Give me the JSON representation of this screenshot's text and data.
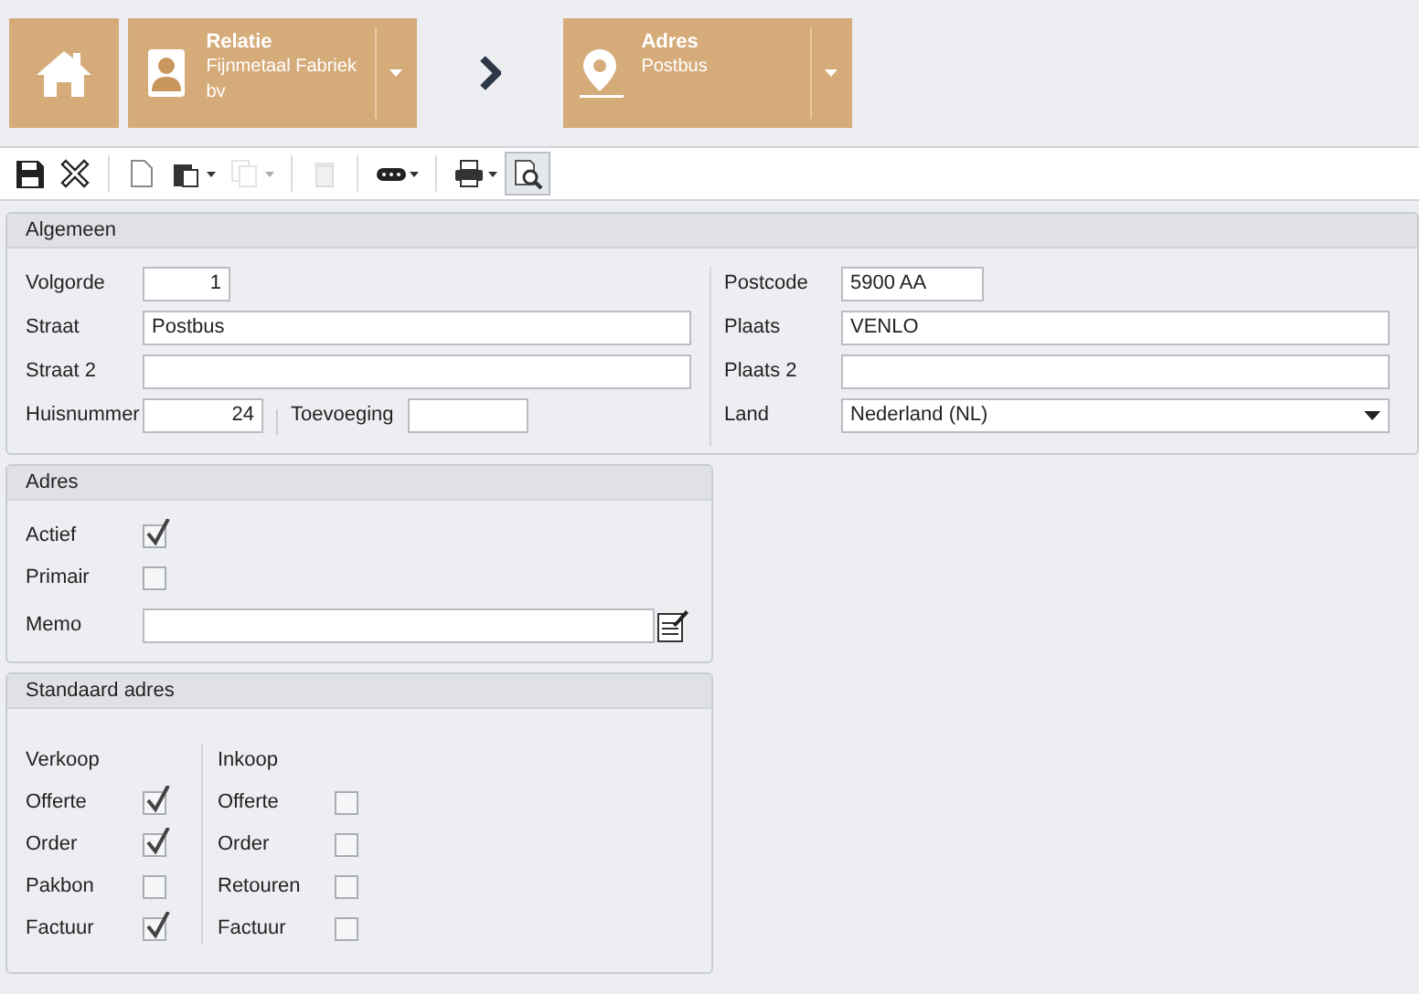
{
  "breadcrumb": [
    {
      "title": "Relatie",
      "subtitle": "Fijnmetaal Fabriek bv",
      "kind": "contact"
    },
    {
      "title": "Adres",
      "subtitle": "Postbus",
      "kind": "pin"
    }
  ],
  "toolbar": [
    {
      "kind": "save",
      "disabled": false,
      "selected": false
    },
    {
      "kind": "close",
      "disabled": false,
      "selected": false
    },
    {
      "kind": "new",
      "disabled": false,
      "selected": false
    },
    {
      "kind": "paste",
      "disabled": false,
      "selected": false
    },
    {
      "kind": "copy",
      "disabled": true,
      "selected": false
    },
    {
      "kind": "delete",
      "disabled": true,
      "selected": false
    },
    {
      "kind": "more",
      "disabled": false,
      "selected": false
    },
    {
      "kind": "print",
      "disabled": false,
      "selected": false
    },
    {
      "kind": "preview",
      "disabled": false,
      "selected": true
    }
  ],
  "algemeen": {
    "title": "Algemeen",
    "volgorde": {
      "label": "Volgorde",
      "value": "1"
    },
    "straat": {
      "label": "Straat",
      "value": "Postbus"
    },
    "straat_2": {
      "label": "Straat 2"
    },
    "huisnummer": {
      "label": "Huisnummer",
      "value": "24"
    },
    "toevoeging": {
      "label": "Toevoeging"
    },
    "postcode": {
      "label": "Postcode",
      "value": "5900 AA"
    },
    "plaats": {
      "label": "Plaats",
      "value": "VENLO"
    },
    "plaats_2": {
      "label": "Plaats 2"
    },
    "land": {
      "label": "Land",
      "value": "Nederland (NL)"
    }
  },
  "adres": {
    "title": "Adres",
    "actief": {
      "label": "Actief",
      "checked": true
    },
    "primair": {
      "label": "Primair",
      "checked": false
    },
    "memo": {
      "label": "Memo"
    }
  },
  "standaard_adres": {
    "title": "Standaard adres",
    "verkoop": {
      "title": "Verkoop",
      "items": [
        {
          "label": "Offerte",
          "checked": true
        },
        {
          "label": "Order",
          "checked": true
        },
        {
          "label": "Pakbon",
          "checked": false
        },
        {
          "label": "Factuur",
          "checked": true
        }
      ]
    },
    "inkoop": {
      "title": "Inkoop",
      "items": [
        {
          "label": "Offerte",
          "checked": false
        },
        {
          "label": "Order",
          "checked": false
        },
        {
          "label": "Retouren",
          "checked": false
        },
        {
          "label": "Factuur",
          "checked": false
        }
      ]
    }
  }
}
